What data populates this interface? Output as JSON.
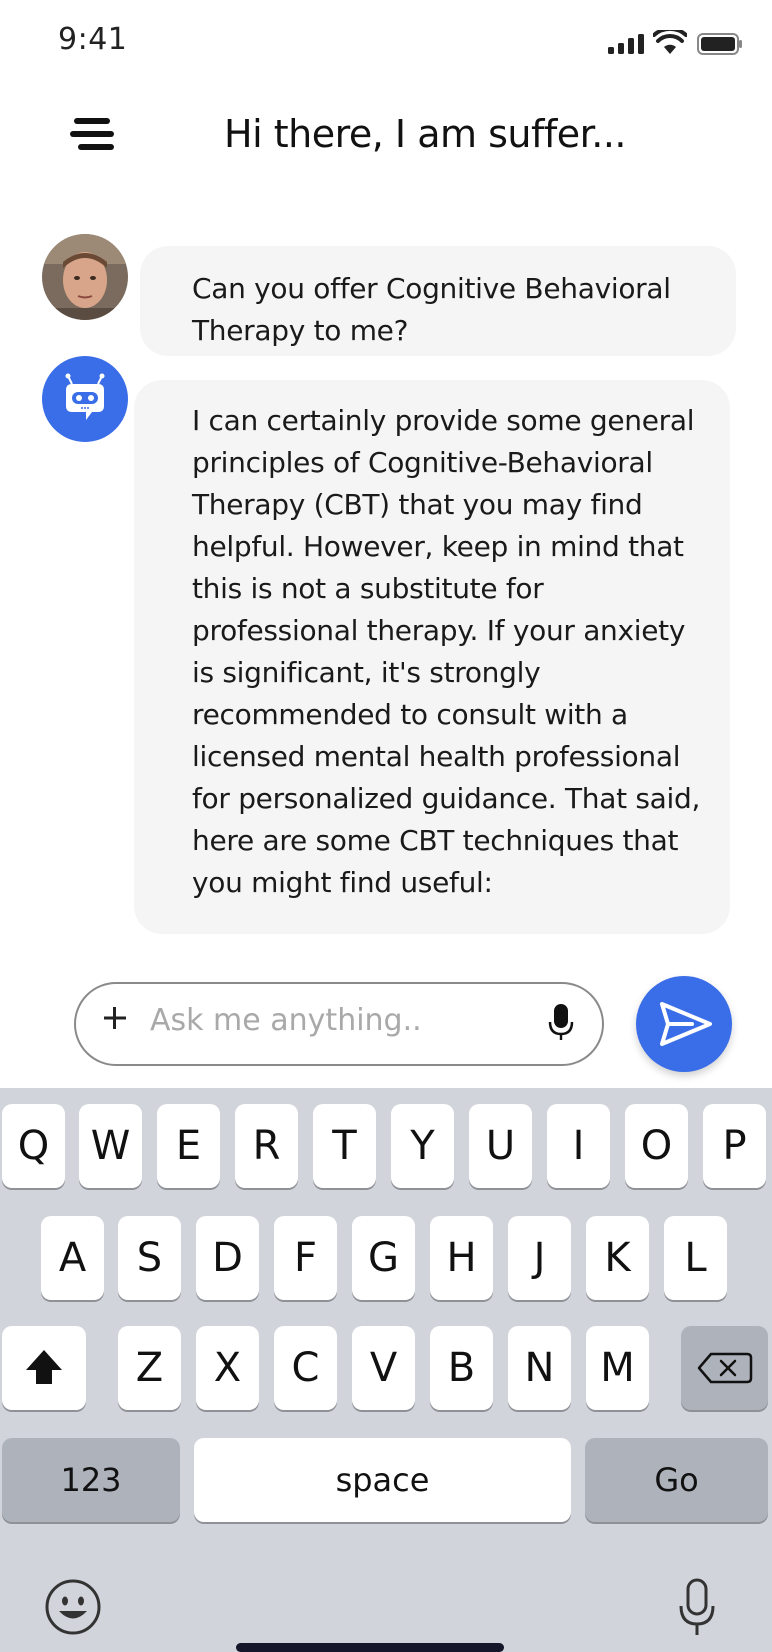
{
  "status_bar": {
    "time": "9:41"
  },
  "header": {
    "title": "Hi there, I am suffer..."
  },
  "messages": [
    {
      "sender": "user",
      "text": "Can you offer Cognitive Behavioral Therapy to me?"
    },
    {
      "sender": "bot",
      "text": "I can certainly provide some general principles of Cognitive-Behavioral Therapy (CBT) that you may find helpful. However, keep in mind that this is not a substitute for professional therapy. If your anxiety is significant, it's strongly recommended to consult with a licensed mental health professional for personalized guidance. That said, here are some CBT techniques that you might find useful:"
    }
  ],
  "composer": {
    "placeholder": "Ask me anything.."
  },
  "keyboard": {
    "row1": [
      "Q",
      "W",
      "E",
      "R",
      "T",
      "Y",
      "U",
      "I",
      "O",
      "P"
    ],
    "row2": [
      "A",
      "S",
      "D",
      "F",
      "G",
      "H",
      "J",
      "K",
      "L"
    ],
    "row3": [
      "Z",
      "X",
      "C",
      "V",
      "B",
      "N",
      "M"
    ],
    "numbers_label": "123",
    "space_label": "space",
    "go_label": "Go"
  },
  "colors": {
    "accent": "#3a6ee8",
    "bubble": "#f5f5f5",
    "keyboard_bg": "#d1d4db"
  }
}
